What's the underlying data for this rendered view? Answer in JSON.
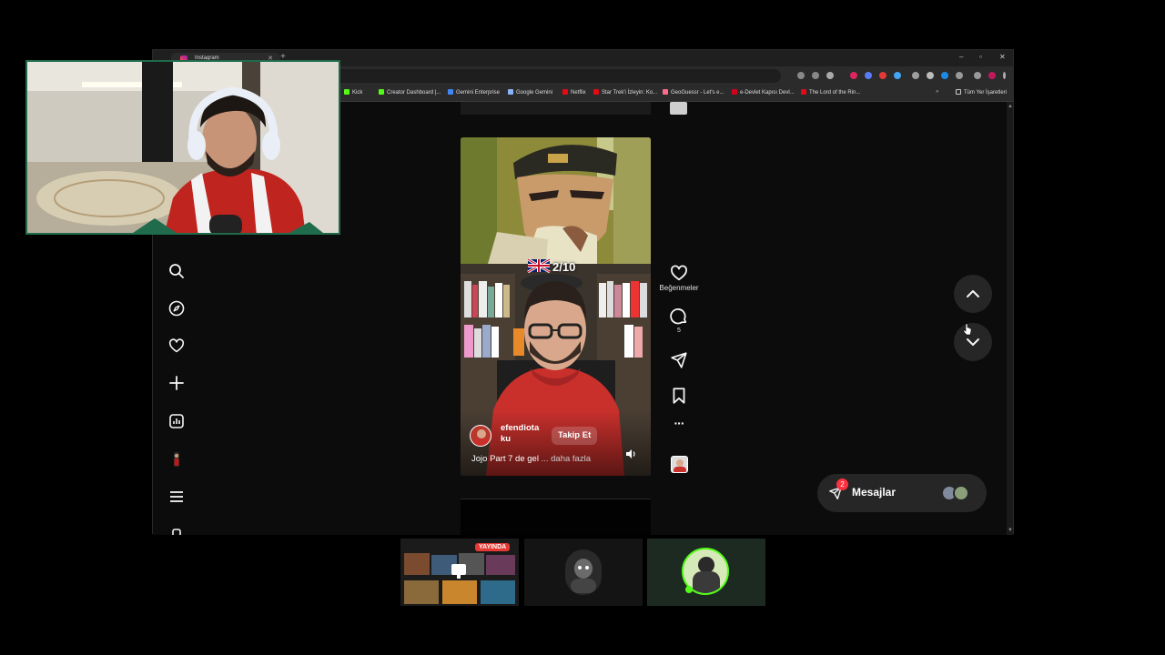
{
  "browser": {
    "tab_title": "Instagram",
    "new_tab": "+",
    "window_controls": [
      "–",
      "▫",
      "✕"
    ],
    "bookmarks": [
      {
        "label": "Kick",
        "color": "#53fc18"
      },
      {
        "label": "Creator Dashboard |...",
        "color": "#53fc18"
      },
      {
        "label": "Gemini Enterprise",
        "color": "#4285f4"
      },
      {
        "label": "Google Gemini",
        "color": "#8ab4f8"
      },
      {
        "label": "Netflix",
        "color": "#e50914"
      },
      {
        "label": "Star Trek'i İzleyin: Ko...",
        "color": "#e50914"
      },
      {
        "label": "GeoGuessr - Let's e...",
        "color": "#ff6b8b"
      },
      {
        "label": "e-Devlet Kapısı Devl...",
        "color": "#d0021b"
      },
      {
        "label": "The Lord of the Rin...",
        "color": "#e50914"
      }
    ],
    "bookmarks_more": "»",
    "all_bookmarks": "Tüm Yer İşaretleri"
  },
  "reel": {
    "episode_badge": "2/10",
    "username": "efendiota ku",
    "follow_label": "Takip Et",
    "caption": "Jojo Part 7 de gel",
    "caption_more": "... daha fazla"
  },
  "actions": {
    "likes_label": "Beğenmeler",
    "comments_count": "5",
    "more": "···"
  },
  "messages": {
    "label": "Mesajlar",
    "badge": "2"
  },
  "stream": {
    "live_label": "YAYINDA"
  },
  "colors": {
    "accent_red": "#ff3040",
    "follow_bg": "rgba(255,255,255,0.15)",
    "webcam_border": "#1f6b4c"
  }
}
